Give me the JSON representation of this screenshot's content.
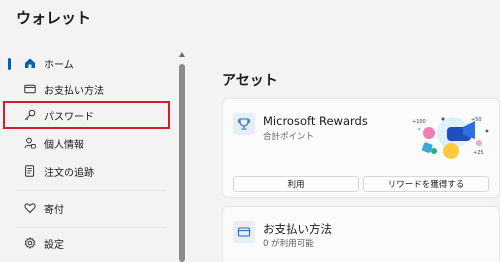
{
  "app": {
    "title": "ウォレット"
  },
  "sidebar": {
    "items": [
      {
        "label": "ホーム",
        "icon": "home-icon",
        "active": true
      },
      {
        "label": "お支払い方法",
        "icon": "credit-card-icon"
      },
      {
        "label": "パスワード",
        "icon": "key-icon",
        "highlighted": true
      },
      {
        "label": "個人情報",
        "icon": "person-icon"
      },
      {
        "label": "注文の追跡",
        "icon": "receipt-icon"
      },
      {
        "label": "寄付",
        "icon": "heart-icon"
      },
      {
        "label": "設定",
        "icon": "gear-icon"
      }
    ]
  },
  "main": {
    "section_title": "アセット",
    "rewards_card": {
      "title": "Microsoft Rewards",
      "subtitle": "合計ポイント",
      "button_use": "利用",
      "button_earn": "リワードを獲得する",
      "icon": "rewards-trophy-icon"
    },
    "payment_card": {
      "title": "お支払い方法",
      "subtitle": "0 が利用可能",
      "icon": "credit-card-icon"
    }
  },
  "colors": {
    "accent": "#005fb8",
    "highlight_border": "#d31f2a"
  }
}
